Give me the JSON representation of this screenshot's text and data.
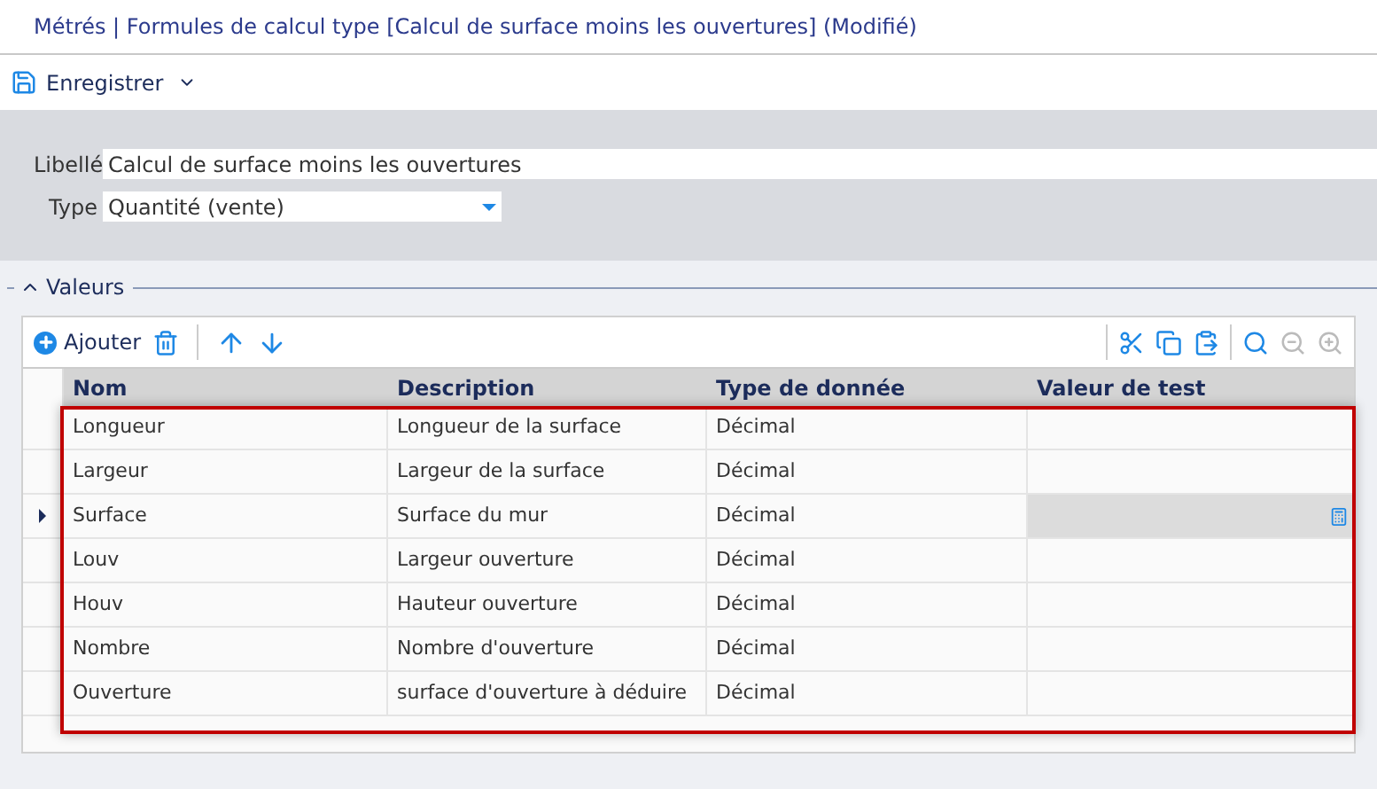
{
  "window": {
    "title": "Métrés | Formules de calcul type [Calcul de surface moins les ouvertures] (Modifié)"
  },
  "toolbar": {
    "save_label": "Enregistrer"
  },
  "form": {
    "libelle_label": "Libellé",
    "libelle_value": "Calcul de surface moins les ouvertures",
    "type_label": "Type",
    "type_value": "Quantité (vente)"
  },
  "section": {
    "title": "Valeurs",
    "expanded": true
  },
  "grid_toolbar": {
    "add_label": "Ajouter"
  },
  "table": {
    "columns": [
      "Nom",
      "Description",
      "Type de donnée",
      "Valeur de test"
    ],
    "rows": [
      {
        "name": "Longueur",
        "description": "Longueur de la surface",
        "type": "Décimal",
        "selected": false
      },
      {
        "name": "Largeur",
        "description": "Largeur de la surface",
        "type": "Décimal",
        "selected": false
      },
      {
        "name": "Surface",
        "description": "Surface du mur",
        "type": "Décimal",
        "selected": true
      },
      {
        "name": "Louv",
        "description": "Largeur ouverture",
        "type": "Décimal",
        "selected": false
      },
      {
        "name": "Houv",
        "description": "Hauteur ouverture",
        "type": "Décimal",
        "selected": false
      },
      {
        "name": "Nombre",
        "description": "Nombre d'ouverture",
        "type": "Décimal",
        "selected": false
      },
      {
        "name": "Ouverture",
        "description": "surface d'ouverture à déduire",
        "type": "Décimal",
        "selected": false
      }
    ]
  }
}
